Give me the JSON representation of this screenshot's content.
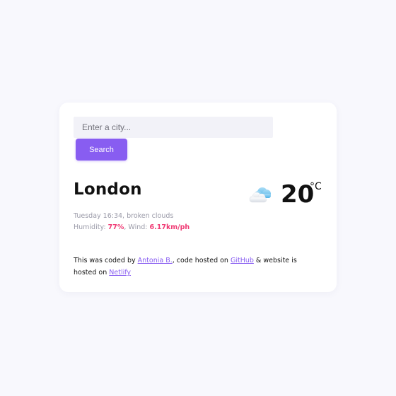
{
  "search": {
    "placeholder": "Enter a city...",
    "button_label": "Search"
  },
  "weather": {
    "city": "London",
    "datetime_description": "Tuesday 16:34, broken clouds",
    "humidity_label": "Humidity: ",
    "humidity_value": "77%",
    "wind_label": ", Wind: ",
    "wind_value": "6.17km/ph",
    "temperature": "20",
    "unit": "°C",
    "icon": "broken-clouds-icon"
  },
  "footer": {
    "text_1": "This was coded by ",
    "author_link": "Antonia B.",
    "text_2": ", code hosted on ",
    "github_link": "GitHub",
    "text_3": " & website is hosted on ",
    "netlify_link": "Netlify"
  },
  "colors": {
    "background": "#f8f8fd",
    "accent": "#885df1",
    "highlight": "#f03a74"
  }
}
